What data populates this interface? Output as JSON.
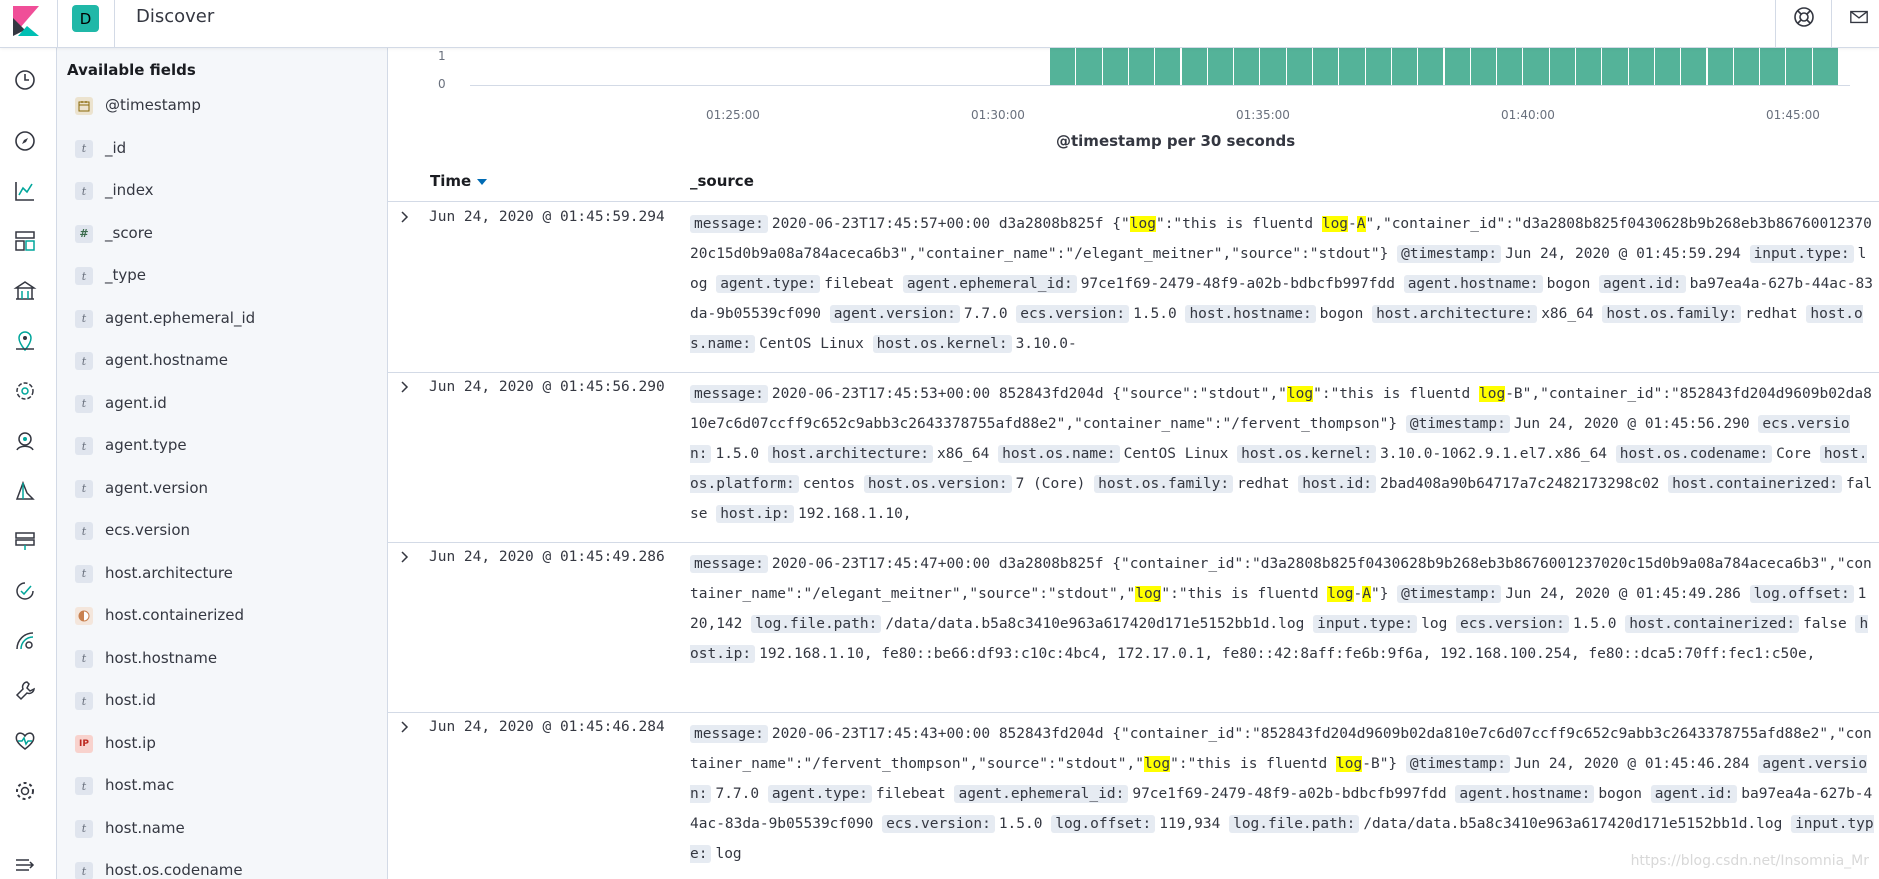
{
  "header": {
    "space_initial": "D",
    "app_title": "Discover",
    "icons": [
      "kibana-logo-icon",
      "help-icon",
      "mail-icon"
    ]
  },
  "leftnav": {
    "icons": [
      "recent-icon",
      "discover-icon",
      "visualize-icon",
      "dashboard-icon",
      "canvas-icon",
      "maps-icon",
      "ml-icon",
      "siem-icon",
      "logs-icon",
      "infrastructure-icon",
      "uptime-icon",
      "apm-icon",
      "dev-tools-icon",
      "stack-monitoring-icon",
      "management-icon",
      "collapse-icon"
    ]
  },
  "fieldpanel": {
    "title": "Available fields",
    "fields": [
      {
        "name": "@timestamp",
        "type": "date"
      },
      {
        "name": "_id",
        "type": "t"
      },
      {
        "name": "_index",
        "type": "t"
      },
      {
        "name": "_score",
        "type": "#"
      },
      {
        "name": "_type",
        "type": "t"
      },
      {
        "name": "agent.ephemeral_id",
        "type": "t"
      },
      {
        "name": "agent.hostname",
        "type": "t"
      },
      {
        "name": "agent.id",
        "type": "t"
      },
      {
        "name": "agent.type",
        "type": "t"
      },
      {
        "name": "agent.version",
        "type": "t"
      },
      {
        "name": "ecs.version",
        "type": "t"
      },
      {
        "name": "host.architecture",
        "type": "t"
      },
      {
        "name": "host.containerized",
        "type": "bool"
      },
      {
        "name": "host.hostname",
        "type": "t"
      },
      {
        "name": "host.id",
        "type": "t"
      },
      {
        "name": "host.ip",
        "type": "ip"
      },
      {
        "name": "host.mac",
        "type": "t"
      },
      {
        "name": "host.name",
        "type": "t"
      },
      {
        "name": "host.os.codename",
        "type": "t"
      }
    ]
  },
  "histogram": {
    "y_ticks": [
      "1",
      "0"
    ],
    "x_ticks": [
      "01:25:00",
      "01:30:00",
      "01:35:00",
      "01:40:00",
      "01:45:00"
    ],
    "x_title": "@timestamp per 30 seconds",
    "bar_count": 30,
    "bar_color": "#54b399"
  },
  "table": {
    "time_header": "Time",
    "source_header": "_source",
    "rows": [
      {
        "time": "Jun 24, 2020 @ 01:45:59.294",
        "html": "<span class='k'>message:</span>2020-06-23T17:45:57+00:00 d3a2808b825f {\"<span class='hl'>log</span>\":\"this is fluentd <span class='hl'>log</span>-<span class='hl'>A</span>\",\"container_id\":\"d3a2808b825f0430628b9b268eb3b8676001237020c15d0b9a08a784aceca6b3\",\"container_name\":\"/elegant_meitner\",\"source\":\"stdout\"} <span class='k'>@timestamp:</span>Jun 24, 2020 @ 01:45:59.294 <span class='k'>input.type:</span>log <span class='k'>agent.type:</span>filebeat <span class='k'>agent.ephemeral_id:</span>97ce1f69-2479-48f9-a02b-bdbcfb997fdd <span class='k'>agent.hostname:</span>bogon <span class='k'>agent.id:</span>ba97ea4a-627b-44ac-83da-9b05539cf090 <span class='k'>agent.version:</span>7.7.0 <span class='k'>ecs.version:</span>1.5.0 <span class='k'>host.hostname:</span>bogon <span class='k'>host.architecture:</span>x86_64 <span class='k'>host.os.family:</span>redhat <span class='k'>host.os.name:</span>CentOS Linux <span class='k'>host.os.kernel:</span>3.10.0-"
      },
      {
        "time": "Jun 24, 2020 @ 01:45:56.290",
        "html": "<span class='k'>message:</span>2020-06-23T17:45:53+00:00 852843fd204d {\"source\":\"stdout\",\"<span class='hl'>log</span>\":\"this is fluentd <span class='hl'>log</span>-B\",\"container_id\":\"852843fd204d9609b02da810e7c6d07ccff9c652c9abb3c2643378755afd88e2\",\"container_name\":\"/fervent_thompson\"} <span class='k'>@timestamp:</span>Jun 24, 2020 @ 01:45:56.290 <span class='k'>ecs.version:</span>1.5.0 <span class='k'>host.architecture:</span>x86_64 <span class='k'>host.os.name:</span>CentOS Linux <span class='k'>host.os.kernel:</span>3.10.0-1062.9.1.el7.x86_64 <span class='k'>host.os.codename:</span>Core <span class='k'>host.os.platform:</span>centos <span class='k'>host.os.version:</span>7 (Core) <span class='k'>host.os.family:</span>redhat <span class='k'>host.id:</span>2bad408a90b64717a7c2482173298c02 <span class='k'>host.containerized:</span>false <span class='k'>host.ip:</span>192.168.1.10,"
      },
      {
        "time": "Jun 24, 2020 @ 01:45:49.286",
        "html": "<span class='k'>message:</span>2020-06-23T17:45:47+00:00 d3a2808b825f {\"container_id\":\"d3a2808b825f0430628b9b268eb3b8676001237020c15d0b9a08a784aceca6b3\",\"container_name\":\"/elegant_meitner\",\"source\":\"stdout\",\"<span class='hl'>log</span>\":\"this is fluentd <span class='hl'>log</span>-<span class='hl'>A</span>\"} <span class='k'>@timestamp:</span>Jun 24, 2020 @ 01:45:49.286 <span class='k'>log.offset:</span>120,142 <span class='k'>log.file.path:</span>/data/data.b5a8c3410e963a617420d171e5152bb1d.log <span class='k'>input.type:</span>log <span class='k'>ecs.version:</span>1.5.0 <span class='k'>host.containerized:</span>false <span class='k'>host.ip:</span>192.168.1.10, fe80::be66:df93:c10c:4bc4, 172.17.0.1, fe80::42:8aff:fe6b:9f6a, 192.168.100.254, fe80::dca5:70ff:fec1:c50e,"
      },
      {
        "time": "Jun 24, 2020 @ 01:45:46.284",
        "html": "<span class='k'>message:</span>2020-06-23T17:45:43+00:00 852843fd204d {\"container_id\":\"852843fd204d9609b02da810e7c6d07ccff9c652c9abb3c2643378755afd88e2\",\"container_name\":\"/fervent_thompson\",\"source\":\"stdout\",\"<span class='hl'>log</span>\":\"this is fluentd <span class='hl'>log</span>-B\"} <span class='k'>@timestamp:</span>Jun 24, 2020 @ 01:45:46.284 <span class='k'>agent.version:</span>7.7.0 <span class='k'>agent.type:</span>filebeat <span class='k'>agent.ephemeral_id:</span>97ce1f69-2479-48f9-a02b-bdbcfb997fdd <span class='k'>agent.hostname:</span>bogon <span class='k'>agent.id:</span>ba97ea4a-627b-44ac-83da-9b05539cf090 <span class='k'>ecs.version:</span>1.5.0 <span class='k'>log.offset:</span>119,934 <span class='k'>log.file.path:</span>/data/data.b5a8c3410e963a617420d171e5152bb1d.log <span class='k'>input.type:</span>log"
      }
    ]
  },
  "watermark": "https://blog.csdn.net/Insomnia_Mr"
}
